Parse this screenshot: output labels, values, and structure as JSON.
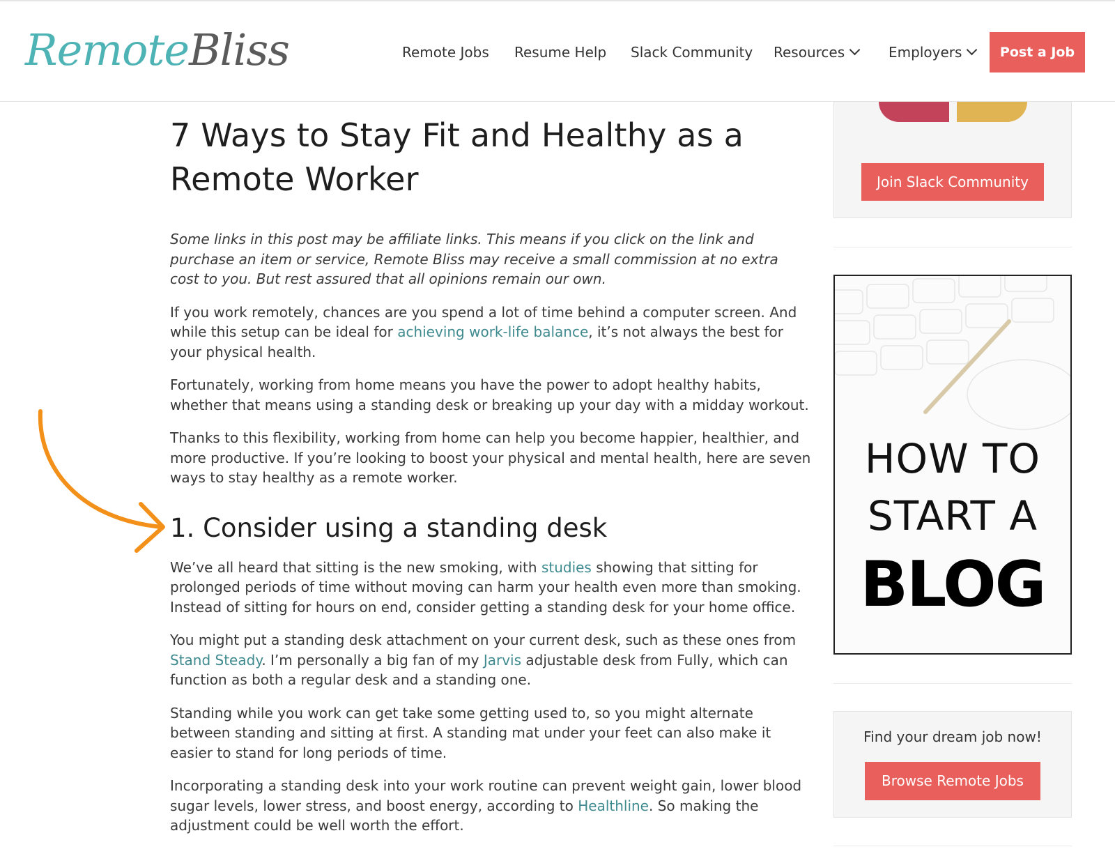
{
  "header": {
    "logo_part1": "Remote",
    "logo_part2": "Bliss",
    "nav": [
      {
        "label": "Remote Jobs"
      },
      {
        "label": "Resume Help"
      },
      {
        "label": "Slack Community"
      },
      {
        "label": "Resources",
        "dropdown": true
      },
      {
        "label": "Employers",
        "dropdown": true
      }
    ],
    "cta": "Post a Job"
  },
  "article": {
    "title": "7 Ways to Stay Fit and Healthy as a Remote Worker",
    "disclaimer": "Some links in this post may be affiliate links. This means if you click on the link and purchase an item or service, Remote Bliss may receive a small commission at no extra cost to you. But rest assured that all opinions remain our own.",
    "p1_a": "If you work remotely, chances are you spend a lot of time behind a computer screen. And while this setup can be ideal for ",
    "p1_link": "achieving work-life balance",
    "p1_b": ", it’s not always the best for your physical health.",
    "p2": "Fortunately, working from home means you have the power to adopt healthy habits, whether that means using a standing desk or breaking up your day with a midday workout.",
    "p3": "Thanks to this flexibility, working from home can help you become happier, healthier, and more productive. If you’re looking to boost your physical and mental health, here are seven ways to stay healthy as a remote worker.",
    "h2": "1. Consider using a standing desk",
    "p4_a": "We’ve all heard that sitting is the new smoking, with ",
    "p4_link": "studies",
    "p4_b": " showing that sitting for prolonged periods of time without moving can harm your health even more than smoking. Instead of sitting for hours on end, consider getting a standing desk for your home office.",
    "p5_a": "You might put a standing desk attachment on your current desk, such as these ones from ",
    "p5_link1": "Stand Steady",
    "p5_b": ". I’m personally a big fan of my ",
    "p5_link2": "Jarvis",
    "p5_c": " adjustable desk from Fully, which can function as both a regular desk and a standing one.",
    "p6": "Standing while you work can get take some getting used to, so you might alternate between standing and sitting at first. A standing mat under your feet can also make it easier to stand for long periods of time.",
    "p7_a": "Incorporating a standing desk into your work routine can prevent weight gain, lower blood sugar levels, lower stress, and boost energy, according to ",
    "p7_link": "Healthline",
    "p7_b": ". So making the adjustment could be well worth the effort."
  },
  "sidebar": {
    "slack_button": "Join Slack Community",
    "blog_line1": "HOW TO",
    "blog_line2": "START A",
    "blog_line3": "BLOG",
    "jobs_text": "Find your dream job now!",
    "jobs_button": "Browse Remote Jobs"
  },
  "colors": {
    "accent": "#e85f5b",
    "logo_teal": "#4eb3b4",
    "link": "#3e8a8e",
    "arrow": "#f39019"
  }
}
